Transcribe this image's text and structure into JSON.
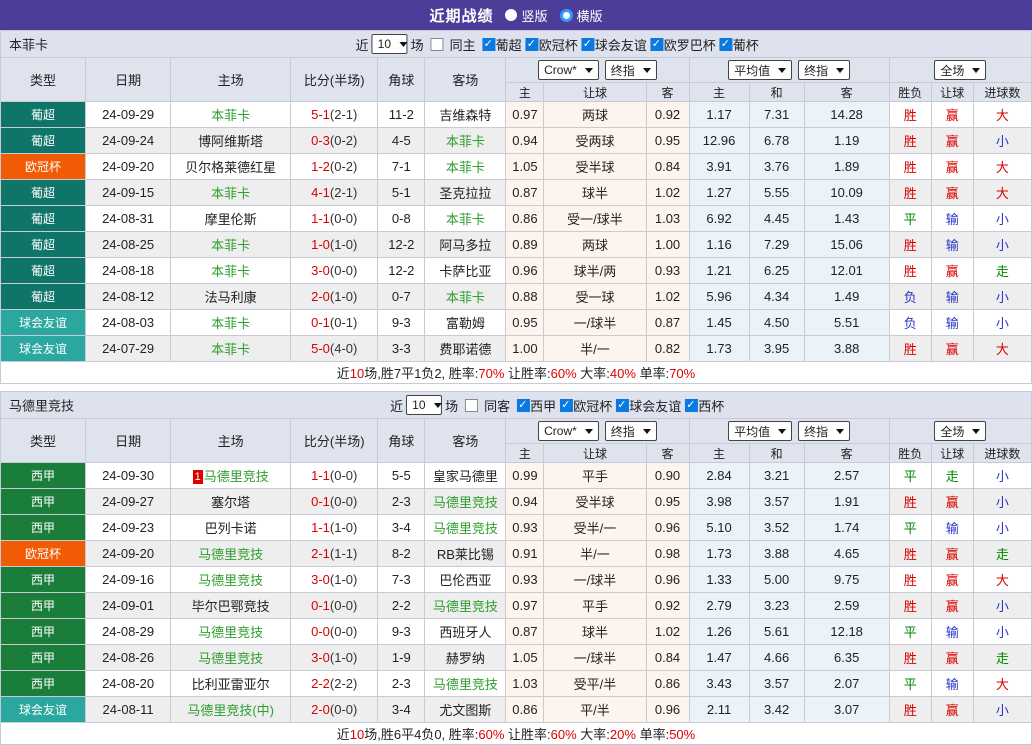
{
  "titlebar": {
    "title": "近期战绩",
    "vertical_label": "竖版",
    "horizontal_label": "横版"
  },
  "header": {
    "col_type": "类型",
    "col_date": "日期",
    "col_home": "主场",
    "col_score": "比分(半场)",
    "col_corner": "角球",
    "col_away": "客场",
    "select_crow": "Crow*",
    "select_final_1": "终指",
    "select_avg": "平均值",
    "select_final_2": "终指",
    "select_full": "全场",
    "sub_home": "主",
    "sub_handicap": "让球",
    "sub_away": "客",
    "sub_avg_home": "主",
    "sub_avg_draw": "和",
    "sub_avg_away": "客",
    "sub_wl": "胜负",
    "sub_hcp": "让球",
    "sub_goals": "进球数"
  },
  "filter": {
    "near": "近",
    "count": "10",
    "games": "场"
  },
  "league_styles": {
    "葡超": "lg-teal",
    "欧冠杯": "lg-orange",
    "球会友谊": "lg-cyan",
    "西甲": "lg-green"
  },
  "result_colors": {
    "胜": "r",
    "平": "g",
    "负": "b",
    "赢": "r",
    "输": "b",
    "走": "g",
    "大": "r",
    "小": "b"
  },
  "colors": {
    "topbar": "#4c3e98",
    "header_bg": "#dee3ee",
    "crow_col_bg": "#fcf4ed",
    "avg_col_bg": "#e9f3f8",
    "teal": "#0e7568",
    "cyan": "#2aa79e",
    "orange": "#f25b05",
    "green": "#1a7d3a",
    "red_text": "#dc0000",
    "green_text": "#008800",
    "blue_text": "#2b35c8",
    "team_green": "#2e9e2e"
  },
  "sections": [
    {
      "team": "本菲卡",
      "same_label": "同主",
      "leagues": [
        "葡超",
        "欧冠杯",
        "球会友谊",
        "欧罗巴杯",
        "葡杯"
      ],
      "rows": [
        {
          "league": "葡超",
          "date": "24-09-29",
          "home": "本菲卡",
          "home_hl": true,
          "badge": "",
          "score": "5-1",
          "half": "(2-1)",
          "corner": "11-2",
          "away": "吉维森特",
          "away_hl": false,
          "odds": [
            "0.97",
            "两球",
            "0.92"
          ],
          "avg": [
            "1.17",
            "7.31",
            "14.28"
          ],
          "res": [
            "胜",
            "赢",
            "大"
          ]
        },
        {
          "league": "葡超",
          "date": "24-09-24",
          "home": "博阿维斯塔",
          "home_hl": false,
          "badge": "",
          "score": "0-3",
          "half": "(0-2)",
          "corner": "4-5",
          "away": "本菲卡",
          "away_hl": true,
          "odds": [
            "0.94",
            "受两球",
            "0.95"
          ],
          "avg": [
            "12.96",
            "6.78",
            "1.19"
          ],
          "res": [
            "胜",
            "赢",
            "小"
          ]
        },
        {
          "league": "欧冠杯",
          "date": "24-09-20",
          "home": "贝尔格莱德红星",
          "home_hl": false,
          "badge": "",
          "score": "1-2",
          "half": "(0-2)",
          "corner": "7-1",
          "away": "本菲卡",
          "away_hl": true,
          "odds": [
            "1.05",
            "受半球",
            "0.84"
          ],
          "avg": [
            "3.91",
            "3.76",
            "1.89"
          ],
          "res": [
            "胜",
            "赢",
            "大"
          ]
        },
        {
          "league": "葡超",
          "date": "24-09-15",
          "home": "本菲卡",
          "home_hl": true,
          "badge": "",
          "score": "4-1",
          "half": "(2-1)",
          "corner": "5-1",
          "away": "圣克拉拉",
          "away_hl": false,
          "odds": [
            "0.87",
            "球半",
            "1.02"
          ],
          "avg": [
            "1.27",
            "5.55",
            "10.09"
          ],
          "res": [
            "胜",
            "赢",
            "大"
          ]
        },
        {
          "league": "葡超",
          "date": "24-08-31",
          "home": "摩里伦斯",
          "home_hl": false,
          "badge": "",
          "score": "1-1",
          "half": "(0-0)",
          "corner": "0-8",
          "away": "本菲卡",
          "away_hl": true,
          "odds": [
            "0.86",
            "受一/球半",
            "1.03"
          ],
          "avg": [
            "6.92",
            "4.45",
            "1.43"
          ],
          "res": [
            "平",
            "输",
            "小"
          ]
        },
        {
          "league": "葡超",
          "date": "24-08-25",
          "home": "本菲卡",
          "home_hl": true,
          "badge": "",
          "score": "1-0",
          "half": "(1-0)",
          "corner": "12-2",
          "away": "阿马多拉",
          "away_hl": false,
          "odds": [
            "0.89",
            "两球",
            "1.00"
          ],
          "avg": [
            "1.16",
            "7.29",
            "15.06"
          ],
          "res": [
            "胜",
            "输",
            "小"
          ]
        },
        {
          "league": "葡超",
          "date": "24-08-18",
          "home": "本菲卡",
          "home_hl": true,
          "badge": "",
          "score": "3-0",
          "half": "(0-0)",
          "corner": "12-2",
          "away": "卡萨比亚",
          "away_hl": false,
          "odds": [
            "0.96",
            "球半/两",
            "0.93"
          ],
          "avg": [
            "1.21",
            "6.25",
            "12.01"
          ],
          "res": [
            "胜",
            "赢",
            "走"
          ]
        },
        {
          "league": "葡超",
          "date": "24-08-12",
          "home": "法马利康",
          "home_hl": false,
          "badge": "",
          "score": "2-0",
          "half": "(1-0)",
          "corner": "0-7",
          "away": "本菲卡",
          "away_hl": true,
          "odds": [
            "0.88",
            "受一球",
            "1.02"
          ],
          "avg": [
            "5.96",
            "4.34",
            "1.49"
          ],
          "res": [
            "负",
            "输",
            "小"
          ]
        },
        {
          "league": "球会友谊",
          "date": "24-08-03",
          "home": "本菲卡",
          "home_hl": true,
          "badge": "",
          "score": "0-1",
          "half": "(0-1)",
          "corner": "9-3",
          "away": "富勒姆",
          "away_hl": false,
          "odds": [
            "0.95",
            "一/球半",
            "0.87"
          ],
          "avg": [
            "1.45",
            "4.50",
            "5.51"
          ],
          "res": [
            "负",
            "输",
            "小"
          ]
        },
        {
          "league": "球会友谊",
          "date": "24-07-29",
          "home": "本菲卡",
          "home_hl": true,
          "badge": "",
          "score": "5-0",
          "half": "(4-0)",
          "corner": "3-3",
          "away": "费耶诺德",
          "away_hl": false,
          "odds": [
            "1.00",
            "半/一",
            "0.82"
          ],
          "avg": [
            "1.73",
            "3.95",
            "3.88"
          ],
          "res": [
            "胜",
            "赢",
            "大"
          ]
        }
      ],
      "footer": [
        [
          "近",
          0
        ],
        [
          "10",
          1
        ],
        [
          "场,胜7平1负2, 胜率:",
          0
        ],
        [
          "70%",
          1
        ],
        [
          " 让胜率:",
          0
        ],
        [
          "60%",
          1
        ],
        [
          " 大率:",
          0
        ],
        [
          "40%",
          1
        ],
        [
          " 单率:",
          0
        ],
        [
          "70%",
          1
        ]
      ]
    },
    {
      "team": "马德里竞技",
      "same_label": "同客",
      "leagues": [
        "西甲",
        "欧冠杯",
        "球会友谊",
        "西杯"
      ],
      "rows": [
        {
          "league": "西甲",
          "date": "24-09-30",
          "home": "马德里竞技",
          "home_hl": true,
          "badge": "1",
          "score": "1-1",
          "half": "(0-0)",
          "corner": "5-5",
          "away": "皇家马德里",
          "away_hl": false,
          "odds": [
            "0.99",
            "平手",
            "0.90"
          ],
          "avg": [
            "2.84",
            "3.21",
            "2.57"
          ],
          "res": [
            "平",
            "走",
            "小"
          ]
        },
        {
          "league": "西甲",
          "date": "24-09-27",
          "home": "塞尔塔",
          "home_hl": false,
          "badge": "",
          "score": "0-1",
          "half": "(0-0)",
          "corner": "2-3",
          "away": "马德里竞技",
          "away_hl": true,
          "odds": [
            "0.94",
            "受半球",
            "0.95"
          ],
          "avg": [
            "3.98",
            "3.57",
            "1.91"
          ],
          "res": [
            "胜",
            "赢",
            "小"
          ]
        },
        {
          "league": "西甲",
          "date": "24-09-23",
          "home": "巴列卡诺",
          "home_hl": false,
          "badge": "",
          "score": "1-1",
          "half": "(1-0)",
          "corner": "3-4",
          "away": "马德里竞技",
          "away_hl": true,
          "odds": [
            "0.93",
            "受半/一",
            "0.96"
          ],
          "avg": [
            "5.10",
            "3.52",
            "1.74"
          ],
          "res": [
            "平",
            "输",
            "小"
          ]
        },
        {
          "league": "欧冠杯",
          "date": "24-09-20",
          "home": "马德里竞技",
          "home_hl": true,
          "badge": "",
          "score": "2-1",
          "half": "(1-1)",
          "corner": "8-2",
          "away": "RB莱比锡",
          "away_hl": false,
          "odds": [
            "0.91",
            "半/一",
            "0.98"
          ],
          "avg": [
            "1.73",
            "3.88",
            "4.65"
          ],
          "res": [
            "胜",
            "赢",
            "走"
          ]
        },
        {
          "league": "西甲",
          "date": "24-09-16",
          "home": "马德里竞技",
          "home_hl": true,
          "badge": "",
          "score": "3-0",
          "half": "(1-0)",
          "corner": "7-3",
          "away": "巴伦西亚",
          "away_hl": false,
          "odds": [
            "0.93",
            "一/球半",
            "0.96"
          ],
          "avg": [
            "1.33",
            "5.00",
            "9.75"
          ],
          "res": [
            "胜",
            "赢",
            "大"
          ]
        },
        {
          "league": "西甲",
          "date": "24-09-01",
          "home": "毕尔巴鄂竞技",
          "home_hl": false,
          "badge": "",
          "score": "0-1",
          "half": "(0-0)",
          "corner": "2-2",
          "away": "马德里竞技",
          "away_hl": true,
          "odds": [
            "0.97",
            "平手",
            "0.92"
          ],
          "avg": [
            "2.79",
            "3.23",
            "2.59"
          ],
          "res": [
            "胜",
            "赢",
            "小"
          ]
        },
        {
          "league": "西甲",
          "date": "24-08-29",
          "home": "马德里竞技",
          "home_hl": true,
          "badge": "",
          "score": "0-0",
          "half": "(0-0)",
          "corner": "9-3",
          "away": "西班牙人",
          "away_hl": false,
          "odds": [
            "0.87",
            "球半",
            "1.02"
          ],
          "avg": [
            "1.26",
            "5.61",
            "12.18"
          ],
          "res": [
            "平",
            "输",
            "小"
          ]
        },
        {
          "league": "西甲",
          "date": "24-08-26",
          "home": "马德里竞技",
          "home_hl": true,
          "badge": "",
          "score": "3-0",
          "half": "(1-0)",
          "corner": "1-9",
          "away": "赫罗纳",
          "away_hl": false,
          "odds": [
            "1.05",
            "一/球半",
            "0.84"
          ],
          "avg": [
            "1.47",
            "4.66",
            "6.35"
          ],
          "res": [
            "胜",
            "赢",
            "走"
          ]
        },
        {
          "league": "西甲",
          "date": "24-08-20",
          "home": "比利亚雷亚尔",
          "home_hl": false,
          "badge": "",
          "score": "2-2",
          "half": "(2-2)",
          "corner": "2-3",
          "away": "马德里竞技",
          "away_hl": true,
          "odds": [
            "1.03",
            "受平/半",
            "0.86"
          ],
          "avg": [
            "3.43",
            "3.57",
            "2.07"
          ],
          "res": [
            "平",
            "输",
            "大"
          ]
        },
        {
          "league": "球会友谊",
          "date": "24-08-11",
          "home": "马德里竞技(中)",
          "home_hl": true,
          "badge": "",
          "score": "2-0",
          "half": "(0-0)",
          "corner": "3-4",
          "away": "尤文图斯",
          "away_hl": false,
          "odds": [
            "0.86",
            "平/半",
            "0.96"
          ],
          "avg": [
            "2.11",
            "3.42",
            "3.07"
          ],
          "res": [
            "胜",
            "赢",
            "小"
          ]
        }
      ],
      "footer": [
        [
          "近",
          0
        ],
        [
          "10",
          1
        ],
        [
          "场,胜6平4负0, 胜率:",
          0
        ],
        [
          "60%",
          1
        ],
        [
          " 让胜率:",
          0
        ],
        [
          "60%",
          1
        ],
        [
          " 大率:",
          0
        ],
        [
          "20%",
          1
        ],
        [
          " 单率:",
          0
        ],
        [
          "50%",
          1
        ]
      ]
    }
  ]
}
